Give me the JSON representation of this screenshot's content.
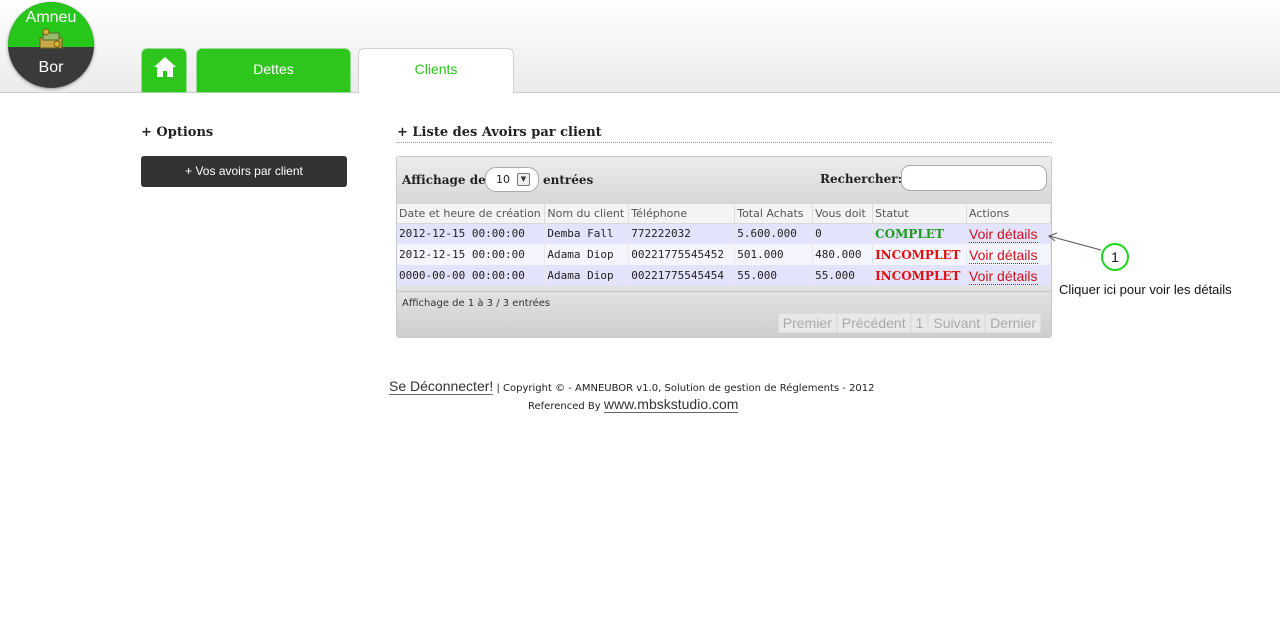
{
  "logo": {
    "line1": "Amneu",
    "line2": "Bor"
  },
  "nav": {
    "tabs": [
      {
        "label": "Dettes"
      },
      {
        "label": "Clients"
      }
    ]
  },
  "sidebar": {
    "title": "+ Options",
    "button_label": "+ Vos avoirs par client"
  },
  "main": {
    "title": "+ Liste des Avoirs par client",
    "length_label": "Affichage de",
    "length_value": "10",
    "length_suffix": "entrées",
    "search_label": "Rechercher:",
    "search_value": "",
    "columns": [
      "Date et heure de création",
      "Nom du client",
      "Téléphone",
      "Total Achats",
      "Vous doit",
      "Statut",
      "Actions"
    ],
    "rows": [
      {
        "date": "2012-12-15 00:00:00",
        "client": "Demba Fall",
        "phone": "772222032",
        "total": "5.600.000",
        "due": "0",
        "status": "COMPLET",
        "action": "Voir détails"
      },
      {
        "date": "2012-12-15 00:00:00",
        "client": "Adama Diop",
        "phone": "00221775545452",
        "total": "501.000",
        "due": "480.000",
        "status": "INCOMPLET",
        "action": "Voir détails"
      },
      {
        "date": "0000-00-00 00:00:00",
        "client": "Adama Diop",
        "phone": "00221775545454",
        "total": "55.000",
        "due": "55.000",
        "status": "INCOMPLET",
        "action": "Voir détails"
      }
    ],
    "info": "Affichage de 1 à 3 / 3 entrées",
    "pager": {
      "first": "Premier",
      "prev": "Précédent",
      "page": "1",
      "next": "Suivant",
      "last": "Dernier"
    }
  },
  "callout": {
    "number": "1",
    "text": "Cliquer ici pour voir les détails"
  },
  "footer": {
    "logout": "Se Déconnecter!",
    "copyright": "| Copyright © - AMNEUBOR v1.0, Solution de gestion de Réglements - 2012",
    "ref_label": "Referenced By",
    "ref_link": "www.mbskstudio.com"
  },
  "colors": {
    "accent": "#2ec51c",
    "status_ok": "#1e9b1e",
    "status_ko": "#e01010",
    "action": "#d0101b"
  }
}
